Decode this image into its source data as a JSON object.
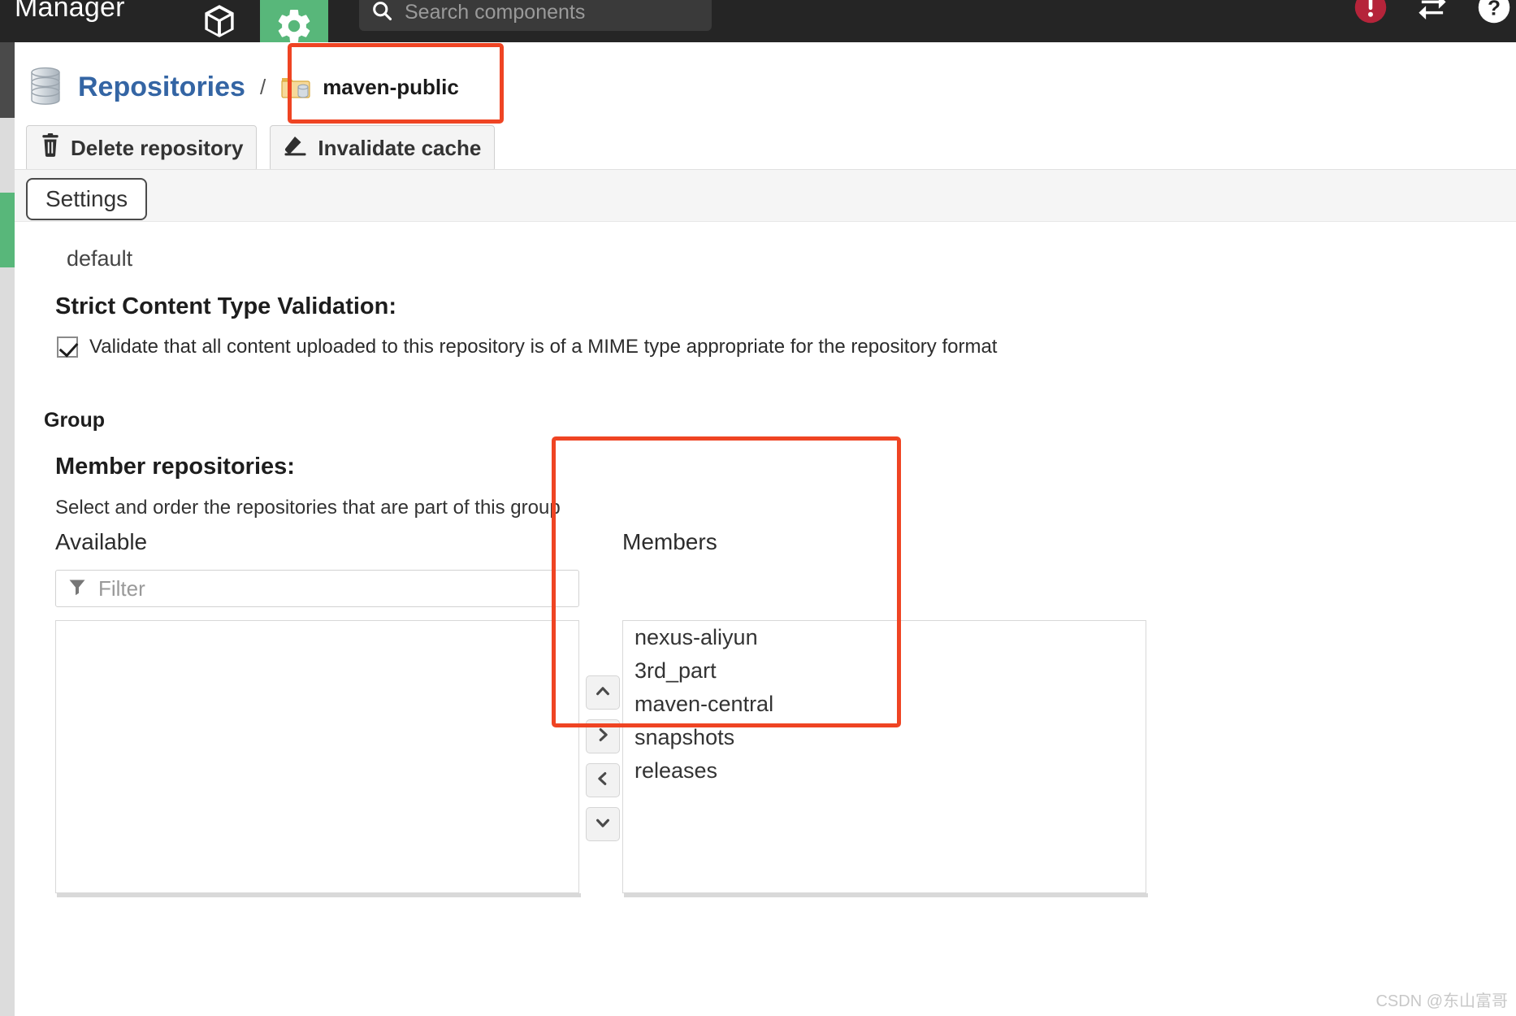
{
  "topbar": {
    "brand_title": "Manager",
    "browse_icon": "cube-icon",
    "admin_icon": "gear-icon",
    "search": {
      "placeholder": "Search components",
      "icon": "search-icon",
      "value": ""
    },
    "right_icons": [
      {
        "name": "alert-icon",
        "label": "!"
      },
      {
        "name": "refresh-icon",
        "label": ""
      },
      {
        "name": "help-icon",
        "label": "?"
      }
    ],
    "active_tab_color": "#58b77a",
    "background_color": "#252525"
  },
  "breadcrumb": {
    "root_icon": "database-icon",
    "root_label": "Repositories",
    "separator": "/",
    "leaf_icon": "repository-folder-icon",
    "leaf_label": "maven-public",
    "root_color": "#3465a4"
  },
  "actions": {
    "delete_icon": "trash-icon",
    "delete_label": "Delete repository",
    "invalidate_icon": "eraser-icon",
    "invalidate_label": "Invalidate cache"
  },
  "tabs": {
    "settings_label": "Settings"
  },
  "settings": {
    "default_value": "default",
    "strict_heading": "Strict Content Type Validation:",
    "strict_checkbox_checked": true,
    "strict_checkbox_label": "Validate that all content uploaded to this repository is of a MIME type appropriate for the repository format",
    "group_heading": "Group",
    "member_heading": "Member repositories:",
    "member_subtitle": "Select and order the repositories that are part of this group"
  },
  "transfer": {
    "available_label": "Available",
    "members_label": "Members",
    "filter": {
      "icon": "filter-icon",
      "placeholder": "Filter",
      "value": ""
    },
    "available_items": [],
    "members_items": [
      "nexus-aliyun",
      "3rd_part",
      "maven-central",
      "snapshots",
      "releases"
    ],
    "arrow_buttons": [
      {
        "name": "move-up-button",
        "icon": "chevron-up-icon"
      },
      {
        "name": "move-right-button",
        "icon": "chevron-right-icon"
      },
      {
        "name": "move-left-button",
        "icon": "chevron-left-icon"
      },
      {
        "name": "move-down-button",
        "icon": "chevron-down-icon"
      }
    ]
  },
  "annotations": {
    "color": "#ef4423",
    "breadcrumb_box": "highlight-breadcrumb",
    "members_box": "highlight-members"
  },
  "watermark": {
    "text": "CSDN @东山富哥"
  }
}
